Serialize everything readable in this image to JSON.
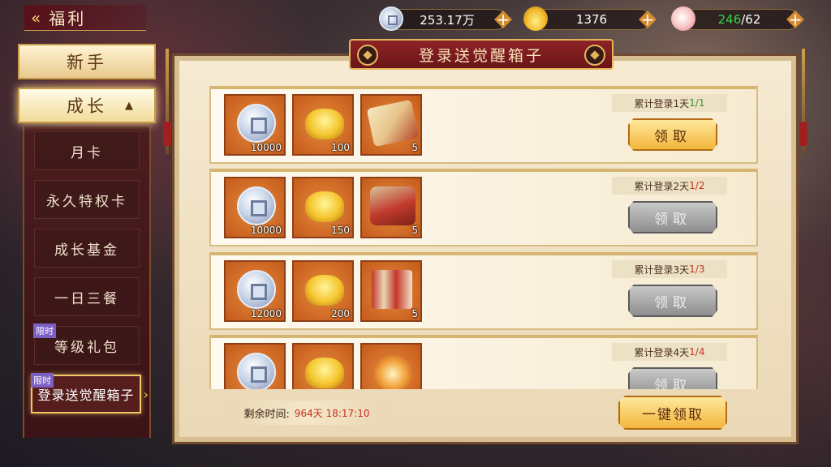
{
  "header": {
    "back_icon": "double-chevron-left-icon",
    "title": "福利"
  },
  "resources": [
    {
      "icon": "silver-coin-icon",
      "value": "253.17万"
    },
    {
      "icon": "gold-ingot-icon",
      "value": "1376"
    },
    {
      "icon": "peach-icon",
      "value_current": "246",
      "value_max": "/62"
    }
  ],
  "menu": {
    "top_items": [
      {
        "label": "新手"
      },
      {
        "label": "成长",
        "expanded": true
      }
    ],
    "sub_items": [
      {
        "label": "月卡"
      },
      {
        "label": "永久特权卡"
      },
      {
        "label": "成长基金"
      },
      {
        "label": "一日三餐"
      },
      {
        "label": "等级礼包",
        "tag": "限时"
      },
      {
        "label": "登录送觉醒箱子",
        "tag": "限时",
        "selected": true
      }
    ]
  },
  "panel": {
    "title": "登录送觉醒箱子",
    "rows": [
      {
        "condition": "累计登录1天",
        "progress": "1/1",
        "claimable": true,
        "button": "领取",
        "rewards": [
          {
            "icon": "silver-coin-icon",
            "qty": "10000"
          },
          {
            "icon": "gold-ingot-icon",
            "qty": "100"
          },
          {
            "icon": "scroll-icon",
            "qty": "5"
          }
        ]
      },
      {
        "condition": "累计登录2天",
        "progress": "1/2",
        "claimable": false,
        "button": "领取",
        "rewards": [
          {
            "icon": "silver-coin-icon",
            "qty": "10000"
          },
          {
            "icon": "gold-ingot-icon",
            "qty": "150"
          },
          {
            "icon": "map-scroll-icon",
            "qty": "5"
          }
        ]
      },
      {
        "condition": "累计登录3天",
        "progress": "1/3",
        "claimable": false,
        "button": "领取",
        "rewards": [
          {
            "icon": "silver-coin-icon",
            "qty": "12000"
          },
          {
            "icon": "gold-ingot-icon",
            "qty": "200"
          },
          {
            "icon": "painting-scroll-icon",
            "qty": "5"
          }
        ]
      },
      {
        "condition": "累计登录4天",
        "progress": "1/4",
        "claimable": false,
        "button": "领取",
        "rewards": [
          {
            "icon": "silver-coin-icon",
            "qty": ""
          },
          {
            "icon": "gold-ingot-icon",
            "qty": ""
          },
          {
            "icon": "lamp-icon",
            "qty": ""
          }
        ]
      }
    ],
    "timer_label": "剩余时间:",
    "timer_value": "964天 18:17:10",
    "claim_all": "一键领取"
  },
  "colors": {
    "accent_gold": "#f2b63d",
    "progress_done": "#3a9a2e",
    "progress_todo": "#c4371f",
    "timer_red": "#c8301e",
    "resource_green": "#36d14b",
    "limited_tag": "#7c5fc4"
  }
}
